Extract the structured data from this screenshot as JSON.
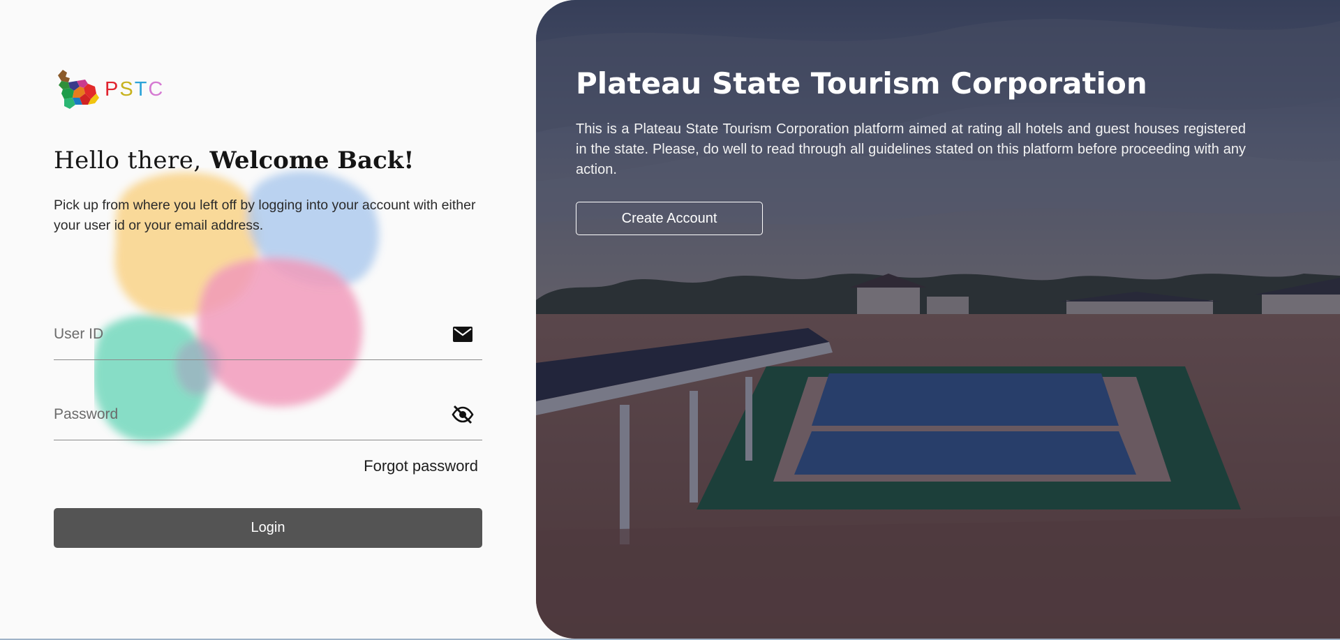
{
  "brand": {
    "logo_text": [
      "P",
      "S",
      "T",
      "C"
    ],
    "colors": {
      "p": "#e0232e",
      "s": "#c7b21e",
      "t": "#2ca3d8",
      "c": "#d57ad2"
    }
  },
  "login": {
    "greeting_light": "Hello there,",
    "greeting_bold": "Welcome Back!",
    "subtitle": "Pick up from where you left off by logging into your account with either your user id or your email address.",
    "user_id_placeholder": "User ID",
    "password_placeholder": "Password",
    "forgot_password": "Forgot password",
    "login_button": "Login",
    "icons": {
      "user_id": "mail-icon",
      "password": "eye-off-icon"
    }
  },
  "hero": {
    "title": "Plateau State Tourism Corporation",
    "description": "This is a Plateau State Tourism Corporation platform aimed at rating all hotels and guest houses registered in the state. Please, do well to read through all guidelines stated on this platform before proceeding with any action.",
    "create_account_button": "Create Account",
    "background": "hotel-pool-scene"
  },
  "theme": {
    "login_button_bg": "#545454",
    "overlay": "rgba(25,28,50,0.55)",
    "page_bg": "#fafafa"
  }
}
